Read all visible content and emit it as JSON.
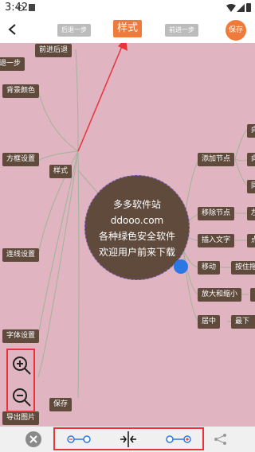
{
  "status_bar": {
    "time": "3:42"
  },
  "toolbar": {
    "back_icon": "chevron-left-icon",
    "undo_label": "后退一步",
    "style_label": "样式",
    "redo_label": "前进一步",
    "save_label": "保存"
  },
  "colors": {
    "canvas_bg": "#e0b4c0",
    "node_bg": "#5f4a3c",
    "accent": "#f07a3a",
    "highlight_red": "#e8333b",
    "handle_blue": "#2b78e4"
  },
  "mindmap": {
    "center_lines": [
      "多多软件站",
      "ddooo.com",
      "各种绿色安全软件",
      "欢迎用户前来下载"
    ],
    "left_branches": {
      "style": "样式",
      "save": "保存"
    },
    "left_leaves": {
      "forward_back": "前进后退",
      "undo_partial": "退一步",
      "bg_color": "背景颜色",
      "border_setting": "方框设置",
      "line_setting": "连线设置",
      "font_setting": "字体设置",
      "export_image": "导出图片"
    },
    "right_branches": {
      "add_node": "添加节点",
      "remove_node": "移除节点",
      "insert_text": "插入文字",
      "move": "移动",
      "zoom": "放大和缩小",
      "center": "居中"
    },
    "right_leaves": {
      "add_a": "向",
      "add_b": "向",
      "add_c": "同",
      "remove_a": "左",
      "insert_a": "点",
      "move_a": "按住拖",
      "zoom_a": "",
      "center_a": "最下"
    }
  },
  "zoom_controls": {
    "zoom_in_icon": "zoom-in-icon",
    "zoom_out_icon": "zoom-out-icon"
  },
  "bottom_bar": {
    "close_icon": "close-icon",
    "decrease_spacing_icon": "link-shrink-icon",
    "center_align_icon": "center-align-icon",
    "increase_spacing_icon": "link-extend-icon",
    "share_icon": "share-node-icon"
  }
}
